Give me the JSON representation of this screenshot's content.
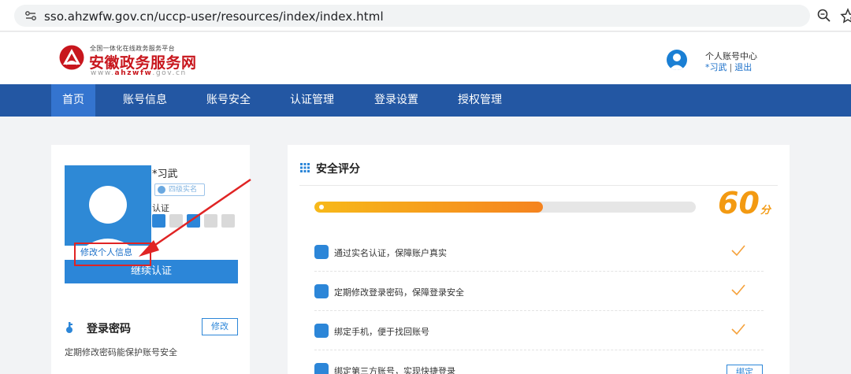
{
  "browser": {
    "url": "sso.ahzwfw.gov.cn/uccp-user/resources/index/index.html"
  },
  "header": {
    "logo_slogan": "全国一体化在线政务服务平台",
    "logo_name": "安徽政务服务网",
    "logo_url_prefix": "www.",
    "logo_url_brand": "ahzwfw",
    "logo_url_suffix": ".gov.cn",
    "account_center": "个人账号中心",
    "user_name": "*习武",
    "separator": "|",
    "logout": "退出"
  },
  "nav": {
    "items": [
      {
        "label": "首页"
      },
      {
        "label": "账号信息"
      },
      {
        "label": "账号安全"
      },
      {
        "label": "认证管理"
      },
      {
        "label": "登录设置"
      },
      {
        "label": "授权管理"
      }
    ]
  },
  "profile": {
    "name": "*习武",
    "badge": "四级实名",
    "cert_label": "认证",
    "edit_link": "修改个人信息",
    "continue_button": "继续认证",
    "password_title": "登录密码",
    "password_modify": "修改",
    "password_desc": "定期修改密码能保护账号安全"
  },
  "security": {
    "title": "安全评分",
    "score": "60",
    "score_unit": "分",
    "progress": 0.6,
    "items": [
      {
        "text": "通过实名认证，保障账户真实",
        "done": true
      },
      {
        "text": "定期修改登录密码，保障登录安全",
        "done": true
      },
      {
        "text": "绑定手机，便于找回账号",
        "done": true
      },
      {
        "text": "绑定第三方账号，实现快捷登录",
        "done": false
      }
    ],
    "bind_button": "绑定"
  },
  "colors": {
    "nav_bg": "#2357a3",
    "nav_active": "#3474cf",
    "brand_red": "#c8161d",
    "primary_blue": "#2c86d8",
    "score_orange": "#f39a12",
    "annotation_red": "#e02424"
  }
}
